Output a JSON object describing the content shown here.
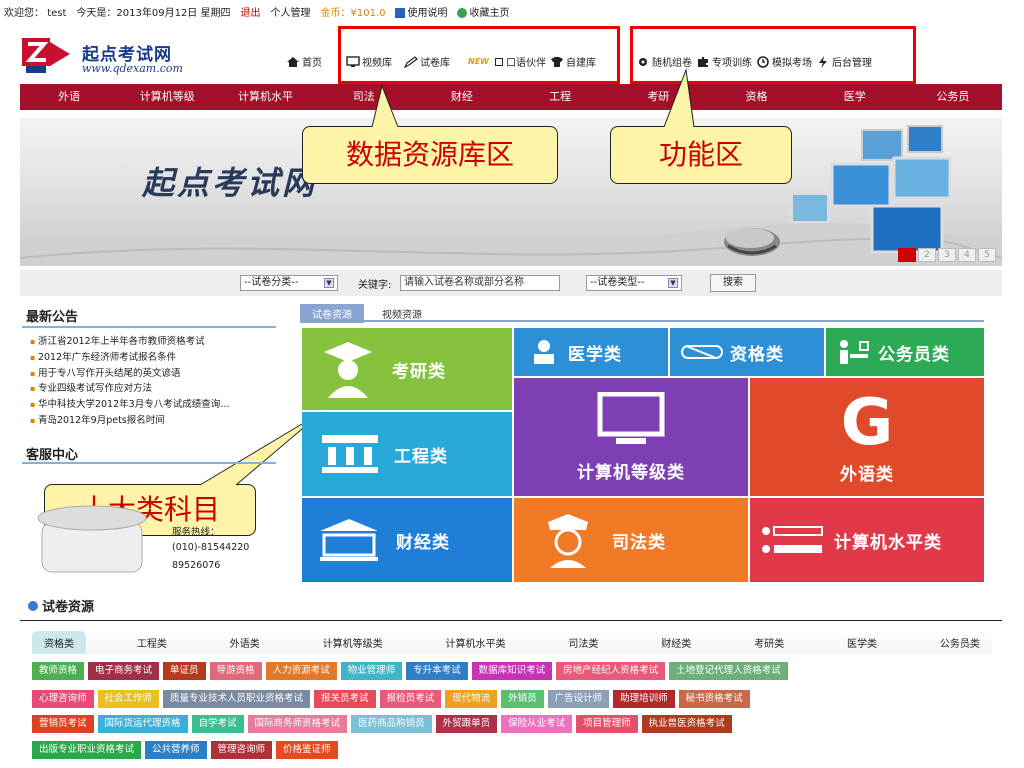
{
  "topbar": {
    "welcome": "欢迎您：",
    "user": "test",
    "today_label": "今天是：",
    "date": "2013年09月12日 星期四",
    "logout": "退出",
    "personal": "个人管理",
    "coins": "金币：¥101.0",
    "manual": "使用说明",
    "bookmark": "收藏主页"
  },
  "logo": {
    "name": "起点考试网",
    "url": "www.qdexam.com"
  },
  "nav": {
    "home": "首页",
    "video": "视频库",
    "papers": "试卷库",
    "new_badge": "NEW",
    "oral": "口语伙伴",
    "self_build": "自建库",
    "random": "随机组卷",
    "special": "专项训练",
    "mock": "模拟考场",
    "admin": "后台管理"
  },
  "categories": [
    "外语",
    "计算机等级",
    "计算机水平",
    "司法",
    "财经",
    "工程",
    "考研",
    "资格",
    "医学",
    "公务员"
  ],
  "banner": {
    "title": "起点考试网",
    "pages": [
      "1",
      "2",
      "3",
      "4",
      "5"
    ]
  },
  "callouts": {
    "data_source": "数据资源库区",
    "function": "功能区",
    "subjects": "十大类科目"
  },
  "search": {
    "category": "--试卷分类--",
    "keyword_label": "关键字:",
    "keyword_value": "请输入试卷名称或部分名称",
    "type": "--试卷类型--",
    "button": "搜索"
  },
  "notices": {
    "title": "最新公告",
    "items": [
      "浙江省2012年上半年各市教师资格考试",
      "2012年广东经济师考试报名条件",
      "用于专八写作开头结尾的英文谚语",
      "专业四级考试写作应对方法",
      "华中科技大学2012年3月专八考试成绩查询…",
      "青岛2012年9月pets报名时间"
    ]
  },
  "service": {
    "title": "客服中心",
    "hotline_label": "服务热线：",
    "phone1": "(010)-81544220",
    "phone2": "89526076"
  },
  "resource_tabs": {
    "papers": "试卷资源",
    "video": "视频资源"
  },
  "tiles": {
    "kaoyan": "考研类",
    "medicine": "医学类",
    "qualification": "资格类",
    "civil": "公务员类",
    "engineering": "工程类",
    "computer_grade": "计算机等级类",
    "foreign": "外语类",
    "finance": "财经类",
    "judicial": "司法类",
    "computer_level": "计算机水平类"
  },
  "paper_resources": {
    "title": "试卷资源",
    "tabs": [
      "资格类",
      "工程类",
      "外语类",
      "计算机等级类",
      "计算机水平类",
      "司法类",
      "财经类",
      "考研类",
      "医学类",
      "公务员类"
    ],
    "rows": [
      [
        {
          "label": "教师资格",
          "color": "#4caf50"
        },
        {
          "label": "电子商务考试",
          "color": "#a0304a"
        },
        {
          "label": "单证员",
          "color": "#b83a1e"
        },
        {
          "label": "导游资格",
          "color": "#e06a7a"
        },
        {
          "label": "人力资源考试",
          "color": "#e07a2a"
        },
        {
          "label": "物业管理师",
          "color": "#3fb6c8"
        },
        {
          "label": "专升本考试",
          "color": "#2f7fc8"
        },
        {
          "label": "数据库知识考试",
          "color": "#c832b8"
        },
        {
          "label": "房地产经纪人资格考试",
          "color": "#e85a78"
        },
        {
          "label": "土地登记代理人资格考试",
          "color": "#6bb07a"
        }
      ],
      [
        {
          "label": "心理咨询师",
          "color": "#e84a7a"
        },
        {
          "label": "社会工作师",
          "color": "#e8c020"
        },
        {
          "label": "质量专业技术人员职业资格考试",
          "color": "#7a8aa0"
        },
        {
          "label": "报关员考试",
          "color": "#e84a5a"
        },
        {
          "label": "报检员考试",
          "color": "#e85a7a"
        },
        {
          "label": "现代物流",
          "color": "#f0a020"
        },
        {
          "label": "外销员",
          "color": "#5ac070"
        },
        {
          "label": "广告设计师",
          "color": "#8aa0b8"
        },
        {
          "label": "助理培训师",
          "color": "#b02a2a"
        },
        {
          "label": "秘书资格考试",
          "color": "#c86a4a"
        }
      ],
      [
        {
          "label": "营销员考试",
          "color": "#e0401e"
        },
        {
          "label": "国际货运代理资格",
          "color": "#3ab0d8"
        },
        {
          "label": "自学考试",
          "color": "#3ac090"
        },
        {
          "label": "国际商务师资格考试",
          "color": "#e87a9a"
        },
        {
          "label": "医药商品购销员",
          "color": "#7ac0d8"
        },
        {
          "label": "外贸跟单员",
          "color": "#b0304a"
        },
        {
          "label": "保险从业考试",
          "color": "#f070c0"
        },
        {
          "label": "项目管理师",
          "color": "#e8506a"
        },
        {
          "label": "执业兽医资格考试",
          "color": "#b03a1e"
        }
      ],
      [
        {
          "label": "出版专业职业资格考试",
          "color": "#2aa84a"
        },
        {
          "label": "公共营养师",
          "color": "#2a80c8"
        },
        {
          "label": "管理咨询师",
          "color": "#b0303a"
        },
        {
          "label": "价格鉴证师",
          "color": "#e84a1e"
        }
      ]
    ]
  },
  "colors": {
    "category_bar": "#a3102a",
    "callout_fill": "#fdf4a8",
    "callout_text": "#cc0000",
    "highlight_box": "#ee0000"
  }
}
